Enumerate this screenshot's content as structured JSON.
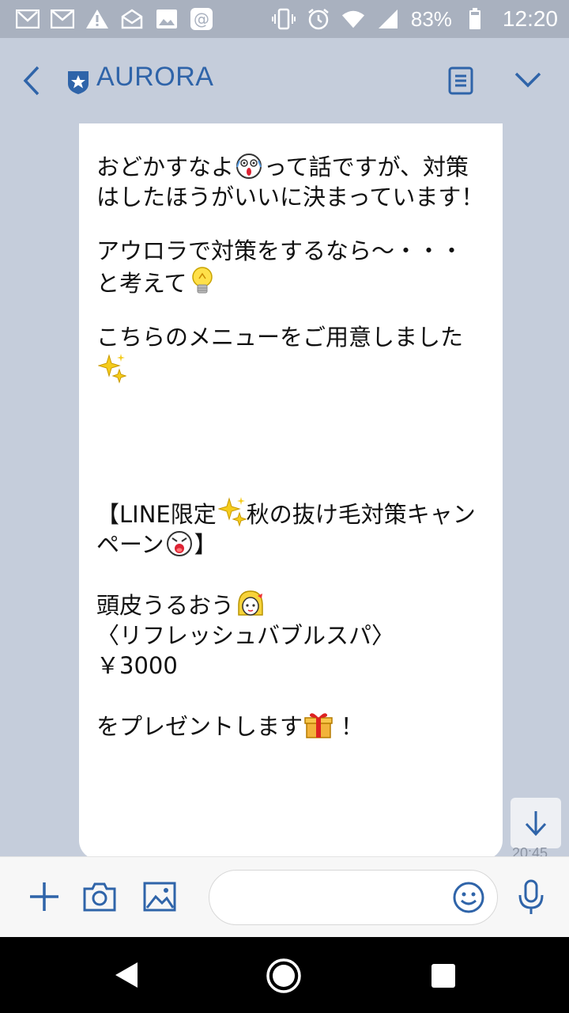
{
  "status_bar": {
    "battery": "83%",
    "time": "12:20"
  },
  "header": {
    "title": "AURORA",
    "icons": [
      "back-icon",
      "official-badge-icon",
      "notes-icon",
      "chevron-down-icon"
    ]
  },
  "message": {
    "p1a": "おどかすなよ",
    "p1b": "って話ですが、対策はしたほうがいいに決まっています！",
    "p2a": "アウロラで対策をするなら〜・・・と考えて",
    "p3a": "こちらのメニューをご用意しました",
    "p4a": "【LINE限定",
    "p4b": "秋の抜け毛対策キャンペーン",
    "p4c": "】",
    "p5a": "頭皮うるおう",
    "p5b": "〈リフレッシュバブルスパ〉",
    "p5c": "￥3000",
    "p6a": "をプレゼントします",
    "p6b": "！",
    "timestamp": "20:45"
  },
  "input_bar": {
    "placeholder": "",
    "icons": [
      "plus-icon",
      "camera-icon",
      "image-icon",
      "emoji-icon",
      "mic-icon"
    ]
  },
  "colors": {
    "accent": "#2f64a9",
    "chat_bg": "#c5cddb",
    "status_bg": "#a9b1bf"
  }
}
